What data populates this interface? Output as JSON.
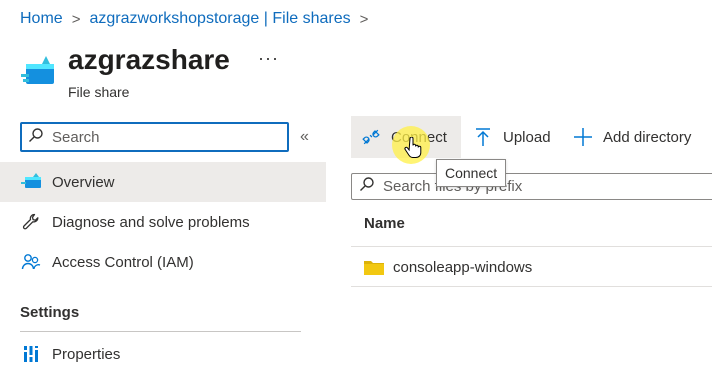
{
  "breadcrumb": {
    "items": [
      "Home",
      "azgrazworkshopstorage | File shares"
    ],
    "separator": ">"
  },
  "resource": {
    "title": "azgrazshare",
    "subtitle": "File share",
    "more": "···",
    "icon": "file-share-icon"
  },
  "sidebar": {
    "search_placeholder": "Search",
    "collapse_glyph": "«",
    "items": [
      {
        "label": "Overview",
        "icon": "file-share-icon",
        "active": true
      },
      {
        "label": "Diagnose and solve problems",
        "icon": "wrench-icon"
      },
      {
        "label": "Access Control (IAM)",
        "icon": "people-icon"
      }
    ],
    "section": "Settings",
    "settings_items": [
      {
        "label": "Properties",
        "icon": "properties-icon"
      }
    ]
  },
  "toolbar": {
    "connect_label": "Connect",
    "upload_label": "Upload",
    "add_directory_label": "Add directory",
    "tooltip": "Connect"
  },
  "files": {
    "search_placeholder": "Search files by prefix",
    "column_name": "Name",
    "rows": [
      {
        "name": "consoleapp-windows",
        "type": "folder"
      }
    ]
  },
  "colors": {
    "accent": "#0f6cbd",
    "selected_bg": "#edebe9",
    "folder": "#f2c811",
    "cursor_highlight": "#fff046"
  }
}
